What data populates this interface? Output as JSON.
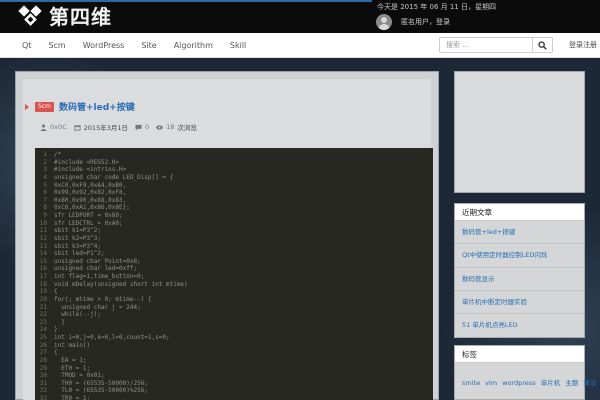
{
  "site": {
    "brand": "第四维",
    "date": "今天是 2015 年 06 月 11 日，星期四",
    "username": "匿名用户，登录"
  },
  "nav": {
    "items": [
      "Qt",
      "Scm",
      "WordPress",
      "Site",
      "Algorithm",
      "Skill"
    ],
    "search_placeholder": "搜索 ...",
    "login": "登录注册"
  },
  "article": {
    "category": "Scm",
    "title": "数码管+led+按键",
    "author": "0x0C",
    "date": "2015年3月1日",
    "comments": "0",
    "views": "18",
    "views_suffix": "次浏览",
    "code_line_numbers": [
      "1",
      "2",
      "3",
      "4",
      "5",
      "6",
      "7",
      "8",
      "9",
      "10",
      "11",
      "12",
      "13",
      "14",
      "15",
      "16",
      "17",
      "18",
      "19",
      "20",
      "21",
      "22",
      "23",
      "24",
      "25",
      "26",
      "27",
      "28",
      "29",
      "30",
      "31",
      "32",
      "33",
      "34"
    ],
    "code_lines": [
      "/*",
      "#include <REG52.H>",
      "#include <intrins.H>",
      "unsigned char code LED_Disp[] = {",
      "0xC0,0xF9,0xA4,0xB0,",
      "0x99,0x92,0x82,0xF8,",
      "0x80,0x90,0x88,0x83,",
      "0xC6,0xA1,0x86,0x8E};",
      "sfr LEDPORT = 0x80;",
      "sfr LEDCTRL = 0xA0;",
      "sbit k1=P3^2;",
      "sbit k2=P3^3;",
      "sbit k3=P3^4;",
      "sbit led=P1^2;",
      "unsigned char Point=0x8;",
      "unsigned char led=0xff;",
      "int flag=1,time_button=0;",
      "void mDelay(unsigned short int mtime)",
      "{",
      "for(; mtime > 0; mtime--) {",
      "  unsigned char j = 244;",
      "  while(--j);",
      "  }",
      "}",
      "int i=0,j=0,k=0,l=0,count=1,s=0;",
      "int main()",
      "{",
      "  EA = 1;",
      "  ET0 = 1;",
      "  TMOD = 0x01;",
      "  TH0 = (65535-50000)/256;",
      "  TL0 = (65535-50000)%256;",
      "  TR0 = 1;",
      "  while(1)"
    ]
  },
  "sidebar": {
    "recent_title": "近期文章",
    "recent_items": [
      "数码管+led+按键",
      "Qt中使用定时器控制LED闪烁",
      "数码管显示",
      "单片机中断定时器实验",
      "51 单片机点亮LED"
    ],
    "tags_title": "标签",
    "tags": [
      "smite",
      "vim",
      "wordpress",
      "单片机",
      "主题",
      "算法",
      "技巧"
    ]
  }
}
